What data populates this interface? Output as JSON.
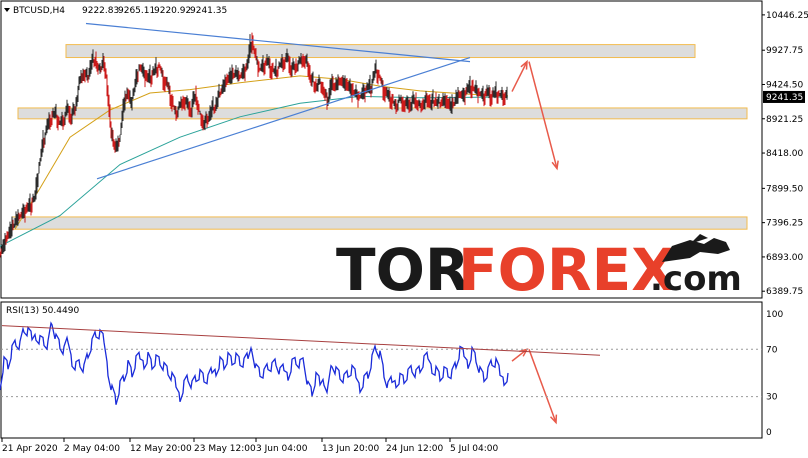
{
  "chart_data": [
    {
      "type": "candlestick",
      "header": {
        "symbol": "BTCUSD,H4",
        "open": "9222.83",
        "high": "9265.11",
        "low": "9220.92",
        "close": "9241.35"
      },
      "price_labels": [
        "10446.25",
        "9927.75",
        "9424.50",
        "8921.25",
        "8418.00",
        "7899.50",
        "7396.25",
        "6893.00",
        "6389.75"
      ],
      "price_values": [
        10446.25,
        9927.75,
        9424.5,
        8921.25,
        8418.0,
        7899.5,
        7396.25,
        6893.0,
        6389.75
      ],
      "ylim": [
        6290,
        10650
      ],
      "current_price_label": "9241.35",
      "current_price": 9241.35,
      "time_labels": [
        "21 Apr 2020",
        "2 May 04:00",
        "12 May 20:00",
        "23 May 12:00",
        "3 Jun 04:00",
        "13 Jun 20:00",
        "24 Jun 12:00",
        "5 Jul 04:00"
      ],
      "zones": [
        {
          "low": 9820,
          "high": 10010
        },
        {
          "low": 8920,
          "high": 9080
        },
        {
          "low": 7300,
          "high": 7480
        }
      ],
      "price_path": [
        [
          0,
          6950
        ],
        [
          4,
          7050
        ],
        [
          8,
          7200
        ],
        [
          12,
          7300
        ],
        [
          16,
          7420
        ],
        [
          20,
          7500
        ],
        [
          24,
          7550
        ],
        [
          28,
          7600
        ],
        [
          32,
          7680
        ],
        [
          36,
          7800
        ],
        [
          40,
          8250
        ],
        [
          44,
          8600
        ],
        [
          48,
          8800
        ],
        [
          52,
          8950
        ],
        [
          56,
          9000
        ],
        [
          60,
          8850
        ],
        [
          64,
          8900
        ],
        [
          68,
          9050
        ],
        [
          72,
          8950
        ],
        [
          76,
          9100
        ],
        [
          80,
          9450
        ],
        [
          84,
          9600
        ],
        [
          88,
          9500
        ],
        [
          92,
          9750
        ],
        [
          96,
          9800
        ],
        [
          100,
          9600
        ],
        [
          104,
          9800
        ],
        [
          108,
          9350
        ],
        [
          112,
          8700
        ],
        [
          116,
          8500
        ],
        [
          120,
          8600
        ],
        [
          124,
          9100
        ],
        [
          128,
          9300
        ],
        [
          132,
          9150
        ],
        [
          136,
          9450
        ],
        [
          140,
          9700
        ],
        [
          144,
          9600
        ],
        [
          148,
          9500
        ],
        [
          152,
          9550
        ],
        [
          156,
          9650
        ],
        [
          160,
          9700
        ],
        [
          164,
          9500
        ],
        [
          168,
          9400
        ],
        [
          172,
          9200
        ],
        [
          176,
          9000
        ],
        [
          180,
          9100
        ],
        [
          184,
          9200
        ],
        [
          188,
          9100
        ],
        [
          192,
          9050
        ],
        [
          196,
          9300
        ],
        [
          200,
          9000
        ],
        [
          204,
          8850
        ],
        [
          208,
          8900
        ],
        [
          212,
          9050
        ],
        [
          216,
          9100
        ],
        [
          220,
          9300
        ],
        [
          224,
          9400
        ],
        [
          228,
          9500
        ],
        [
          232,
          9550
        ],
        [
          236,
          9600
        ],
        [
          240,
          9550
        ],
        [
          244,
          9600
        ],
        [
          248,
          9700
        ],
        [
          252,
          10100
        ],
        [
          256,
          9850
        ],
        [
          260,
          9650
        ],
        [
          264,
          9700
        ],
        [
          268,
          9750
        ],
        [
          272,
          9650
        ],
        [
          276,
          9600
        ],
        [
          280,
          9700
        ],
        [
          284,
          9750
        ],
        [
          288,
          9800
        ],
        [
          292,
          9650
        ],
        [
          296,
          9700
        ],
        [
          300,
          9750
        ],
        [
          304,
          9800
        ],
        [
          308,
          9700
        ],
        [
          312,
          9500
        ],
        [
          316,
          9400
        ],
        [
          320,
          9450
        ],
        [
          324,
          9350
        ],
        [
          328,
          9150
        ],
        [
          332,
          9450
        ],
        [
          336,
          9400
        ],
        [
          340,
          9500
        ],
        [
          344,
          9450
        ],
        [
          348,
          9400
        ],
        [
          352,
          9350
        ],
        [
          356,
          9300
        ],
        [
          360,
          9250
        ],
        [
          364,
          9300
        ],
        [
          368,
          9350
        ],
        [
          372,
          9400
        ],
        [
          376,
          9650
        ],
        [
          380,
          9550
        ],
        [
          384,
          9350
        ],
        [
          388,
          9250
        ],
        [
          392,
          9200
        ],
        [
          396,
          9100
        ],
        [
          400,
          9200
        ],
        [
          404,
          9150
        ],
        [
          408,
          9100
        ],
        [
          412,
          9150
        ],
        [
          416,
          9200
        ],
        [
          420,
          9100
        ],
        [
          424,
          9150
        ],
        [
          428,
          9200
        ],
        [
          432,
          9150
        ],
        [
          436,
          9200
        ],
        [
          440,
          9150
        ],
        [
          444,
          9200
        ],
        [
          448,
          9150
        ],
        [
          452,
          9100
        ],
        [
          456,
          9200
        ],
        [
          460,
          9300
        ],
        [
          464,
          9250
        ],
        [
          468,
          9350
        ],
        [
          472,
          9400
        ],
        [
          476,
          9350
        ],
        [
          480,
          9300
        ],
        [
          484,
          9250
        ],
        [
          488,
          9300
        ],
        [
          492,
          9250
        ],
        [
          496,
          9300
        ],
        [
          500,
          9270
        ],
        [
          504,
          9250
        ],
        [
          508,
          9241
        ]
      ],
      "ma_slow": [
        [
          0,
          7050
        ],
        [
          60,
          7500
        ],
        [
          120,
          8250
        ],
        [
          180,
          8650
        ],
        [
          240,
          8950
        ],
        [
          300,
          9150
        ],
        [
          360,
          9250
        ],
        [
          420,
          9230
        ],
        [
          508,
          9240
        ]
      ],
      "ma_fast": [
        [
          15,
          7300
        ],
        [
          40,
          7900
        ],
        [
          70,
          8650
        ],
        [
          110,
          9050
        ],
        [
          150,
          9300
        ],
        [
          190,
          9350
        ],
        [
          240,
          9450
        ],
        [
          300,
          9550
        ],
        [
          340,
          9500
        ],
        [
          380,
          9400
        ],
        [
          420,
          9330
        ],
        [
          470,
          9280
        ],
        [
          508,
          9260
        ]
      ],
      "trendlines": [
        {
          "x0": 86,
          "y0": 10320,
          "x1": 470,
          "y1": 9760
        },
        {
          "x0": 97,
          "y0": 8040,
          "x1": 470,
          "y1": 9820
        }
      ],
      "forecast": [
        {
          "x0": 512,
          "y0": 9320,
          "x1": 527,
          "y1": 9760
        },
        {
          "x0": 529,
          "y0": 9760,
          "x1": 557,
          "y1": 8190
        }
      ]
    },
    {
      "type": "line",
      "label": "RSI(13) 50.4490",
      "levels_labels": [
        "100",
        "70",
        "30",
        "0"
      ],
      "levels": [
        100,
        70,
        30,
        0
      ],
      "ylim": [
        -5,
        110
      ],
      "values": [
        [
          0,
          42
        ],
        [
          4,
          62
        ],
        [
          8,
          58
        ],
        [
          12,
          70
        ],
        [
          16,
          76
        ],
        [
          20,
          72
        ],
        [
          24,
          86
        ],
        [
          28,
          82
        ],
        [
          32,
          78
        ],
        [
          36,
          84
        ],
        [
          40,
          80
        ],
        [
          44,
          78
        ],
        [
          48,
          74
        ],
        [
          52,
          94
        ],
        [
          56,
          78
        ],
        [
          60,
          72
        ],
        [
          64,
          66
        ],
        [
          68,
          76
        ],
        [
          72,
          62
        ],
        [
          76,
          58
        ],
        [
          80,
          60
        ],
        [
          84,
          54
        ],
        [
          88,
          66
        ],
        [
          92,
          74
        ],
        [
          96,
          82
        ],
        [
          100,
          80
        ],
        [
          104,
          76
        ],
        [
          108,
          54
        ],
        [
          112,
          38
        ],
        [
          116,
          28
        ],
        [
          120,
          40
        ],
        [
          124,
          46
        ],
        [
          128,
          56
        ],
        [
          132,
          48
        ],
        [
          136,
          58
        ],
        [
          140,
          62
        ],
        [
          144,
          60
        ],
        [
          148,
          66
        ],
        [
          152,
          58
        ],
        [
          156,
          62
        ],
        [
          160,
          60
        ],
        [
          164,
          54
        ],
        [
          168,
          50
        ],
        [
          172,
          44
        ],
        [
          176,
          38
        ],
        [
          180,
          32
        ],
        [
          184,
          42
        ],
        [
          188,
          48
        ],
        [
          192,
          40
        ],
        [
          196,
          46
        ],
        [
          200,
          48
        ],
        [
          204,
          44
        ],
        [
          208,
          42
        ],
        [
          212,
          50
        ],
        [
          216,
          54
        ],
        [
          220,
          62
        ],
        [
          224,
          58
        ],
        [
          228,
          64
        ],
        [
          232,
          60
        ],
        [
          236,
          62
        ],
        [
          240,
          58
        ],
        [
          244,
          56
        ],
        [
          248,
          62
        ],
        [
          252,
          74
        ],
        [
          256,
          56
        ],
        [
          260,
          52
        ],
        [
          264,
          50
        ],
        [
          268,
          56
        ],
        [
          272,
          54
        ],
        [
          276,
          58
        ],
        [
          280,
          48
        ],
        [
          284,
          52
        ],
        [
          288,
          50
        ],
        [
          292,
          60
        ],
        [
          296,
          62
        ],
        [
          300,
          58
        ],
        [
          304,
          60
        ],
        [
          308,
          38
        ],
        [
          312,
          32
        ],
        [
          316,
          44
        ],
        [
          320,
          40
        ],
        [
          324,
          46
        ],
        [
          328,
          38
        ],
        [
          332,
          60
        ],
        [
          336,
          52
        ],
        [
          340,
          48
        ],
        [
          344,
          44
        ],
        [
          348,
          48
        ],
        [
          352,
          50
        ],
        [
          356,
          46
        ],
        [
          360,
          40
        ],
        [
          364,
          46
        ],
        [
          368,
          50
        ],
        [
          372,
          62
        ],
        [
          376,
          72
        ],
        [
          380,
          64
        ],
        [
          384,
          48
        ],
        [
          388,
          36
        ],
        [
          392,
          42
        ],
        [
          396,
          44
        ],
        [
          400,
          48
        ],
        [
          404,
          46
        ],
        [
          408,
          50
        ],
        [
          412,
          54
        ],
        [
          416,
          48
        ],
        [
          420,
          52
        ],
        [
          424,
          58
        ],
        [
          428,
          62
        ],
        [
          432,
          56
        ],
        [
          436,
          54
        ],
        [
          440,
          48
        ],
        [
          444,
          52
        ],
        [
          448,
          50
        ],
        [
          452,
          48
        ],
        [
          456,
          56
        ],
        [
          460,
          66
        ],
        [
          464,
          64
        ],
        [
          468,
          60
        ],
        [
          472,
          70
        ],
        [
          476,
          64
        ],
        [
          480,
          52
        ],
        [
          484,
          46
        ],
        [
          488,
          50
        ],
        [
          492,
          58
        ],
        [
          496,
          56
        ],
        [
          500,
          48
        ],
        [
          504,
          46
        ],
        [
          508,
          50
        ]
      ],
      "trendline": {
        "x0": 2,
        "y0": 90,
        "x1": 600,
        "y1": 65
      },
      "forecast": [
        {
          "x0": 512,
          "y0": 60,
          "x1": 527,
          "y1": 70
        },
        {
          "x0": 529,
          "y0": 70,
          "x1": 556,
          "y1": 8
        }
      ]
    }
  ],
  "watermark": {
    "part1": "TOR",
    "part2": "FOREX",
    "part3": ".com"
  },
  "colors": {
    "bull": "#2b2b2b",
    "bear": "#cc1a1a",
    "ma_slow": "#2ba39a",
    "ma_fast": "#d4a017",
    "trendline": "#4a7fd4",
    "zone_fill": "#d8d8d8",
    "zone_border": "#f0b030",
    "forecast": "#e85a4a",
    "rsi": "#1a2bd9",
    "rsi_trend": "#a84040"
  }
}
